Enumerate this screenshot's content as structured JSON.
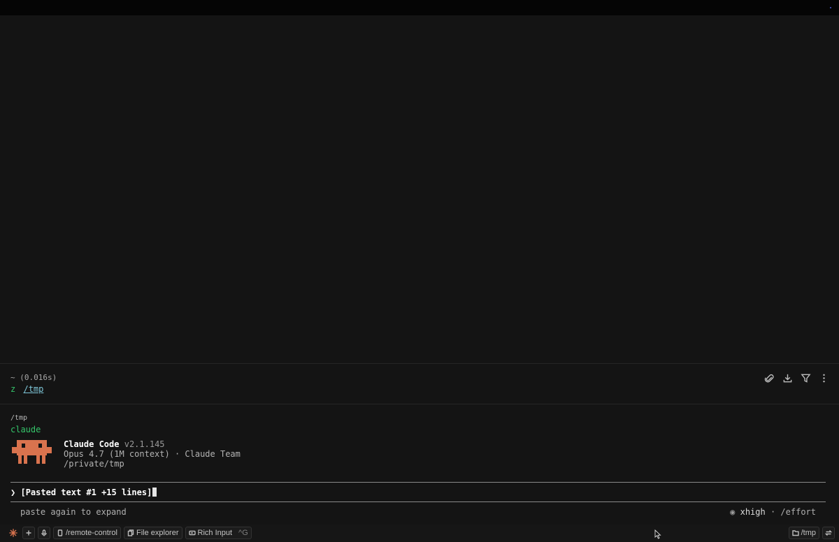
{
  "terminal": {
    "timing": "~ (0.016s)",
    "prompt_char": "z",
    "prompt_path": "/tmp",
    "cwd": "/tmp",
    "command": "claude"
  },
  "toolbar_icons": [
    "paperclip-icon",
    "download-icon",
    "filter-icon",
    "more-icon"
  ],
  "claude": {
    "name": "Claude Code",
    "version": "v2.1.145",
    "model_line": "Opus 4.7 (1M context) · Claude Team",
    "path": "/private/tmp",
    "mascot_color": "#d9734e"
  },
  "input": {
    "prompt": "❯",
    "value": "[Pasted text #1 +15 lines]"
  },
  "footer": {
    "hint": "paste again to expand",
    "effort_icon": "◉",
    "effort_level": "xhigh",
    "effort_sep": "·",
    "effort_cmd": "/effort"
  },
  "statusbar": {
    "remote": "/remote-control",
    "file_explorer": "File explorer",
    "rich_input": "Rich Input",
    "rich_input_shortcut": "^G",
    "dir": "/tmp"
  },
  "colors": {
    "background": "#141414",
    "green": "#35c46a",
    "link": "#7fc7d9",
    "accent": "#d9734e"
  }
}
